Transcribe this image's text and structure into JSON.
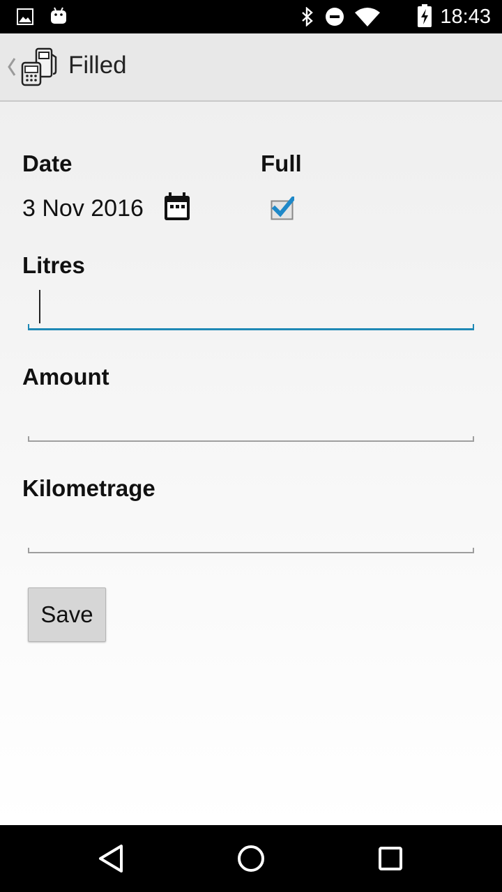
{
  "status_bar": {
    "time": "18:43",
    "left_icons": [
      "image-notification-icon",
      "android-notification-icon"
    ],
    "right_icons": [
      "bluetooth-icon",
      "do-not-disturb-icon",
      "wifi-icon",
      "battery-charging-icon"
    ]
  },
  "action_bar": {
    "title": "Filled",
    "back_icon": "chevron-left-icon",
    "app_icon": "fuel-pump-icon"
  },
  "form": {
    "date_label": "Date",
    "date_value": "3 Nov 2016",
    "full_label": "Full",
    "full_checked": true,
    "litres_label": "Litres",
    "litres_value": "",
    "amount_label": "Amount",
    "amount_value": "",
    "kilometrage_label": "Kilometrage",
    "kilometrage_value": "",
    "save_label": "Save"
  },
  "colors": {
    "accent": "#1e88b5",
    "checkbox_check": "#1e88c8"
  },
  "nav_bar": {
    "buttons": [
      "back-triangle-icon",
      "home-circle-icon",
      "recents-square-icon"
    ]
  }
}
